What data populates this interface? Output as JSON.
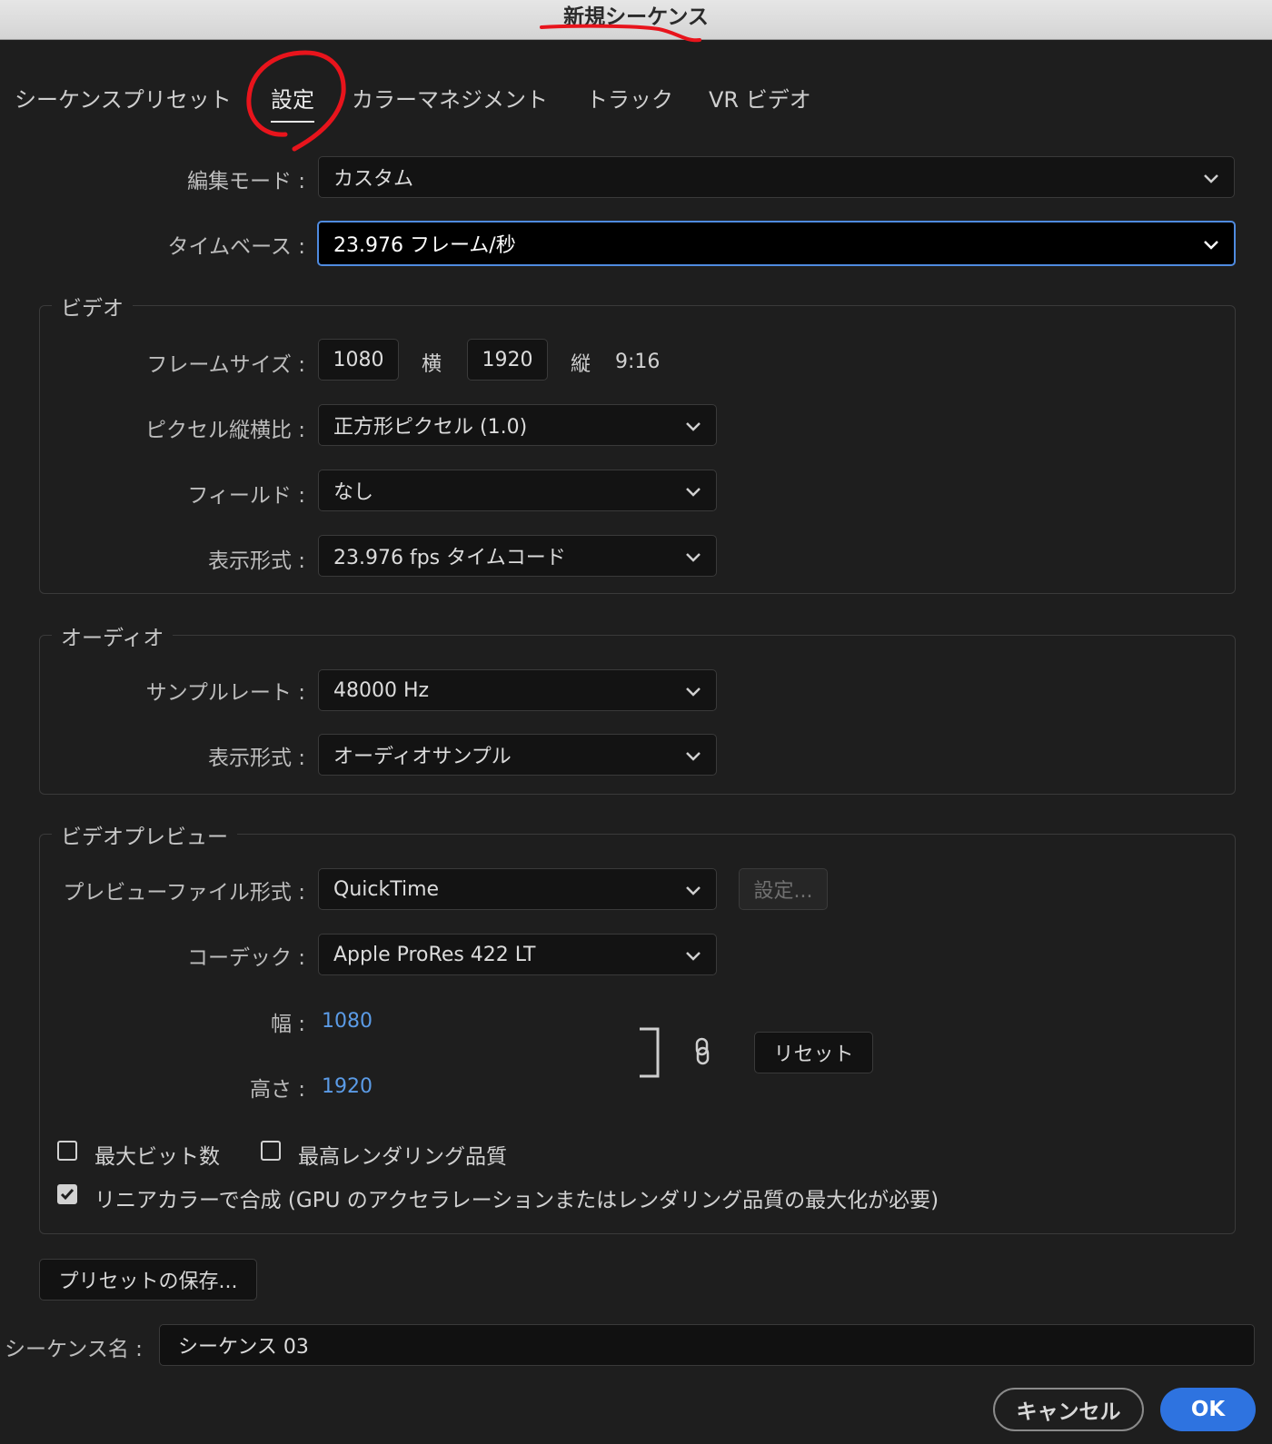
{
  "window": {
    "title": "新規シーケンス"
  },
  "tabs": [
    {
      "label": "シーケンスプリセット"
    },
    {
      "label": "設定"
    },
    {
      "label": "カラーマネジメント"
    },
    {
      "label": "トラック"
    },
    {
      "label": "VR ビデオ"
    }
  ],
  "general": {
    "editing_mode_label": "編集モード :",
    "editing_mode_value": "カスタム",
    "timebase_label": "タイムベース :",
    "timebase_value": "23.976  フレーム/秒"
  },
  "video": {
    "group_title": "ビデオ",
    "frame_size_label": "フレームサイズ :",
    "frame_width": "1080",
    "horizontal_label": "横",
    "frame_height": "1920",
    "vertical_label": "縦",
    "aspect": "9:16",
    "pixel_aspect_label": "ピクセル縦横比 :",
    "pixel_aspect_value": "正方形ピクセル (1.0)",
    "fields_label": "フィールド :",
    "fields_value": "なし",
    "display_format_label": "表示形式 :",
    "display_format_value": "23.976 fps タイムコード"
  },
  "audio": {
    "group_title": "オーディオ",
    "sample_rate_label": "サンプルレート :",
    "sample_rate_value": "48000 Hz",
    "display_format_label": "表示形式 :",
    "display_format_value": "オーディオサンプル"
  },
  "preview": {
    "group_title": "ビデオプレビュー",
    "file_format_label": "プレビューファイル形式 :",
    "file_format_value": "QuickTime",
    "settings_button": "設定...",
    "codec_label": "コーデック :",
    "codec_value": "Apple ProRes 422 LT",
    "width_label": "幅 :",
    "width_value": "1080",
    "height_label": "高さ :",
    "height_value": "1920",
    "reset_button": "リセット",
    "max_bit_depth": "最大ビット数",
    "max_render_quality": "最高レンダリング品質",
    "linear_color": "リニアカラーで合成 (GPU のアクセラレーションまたはレンダリング品質の最大化が必要)",
    "max_bit_depth_checked": false,
    "max_render_quality_checked": false,
    "linear_color_checked": true
  },
  "footer": {
    "save_preset_button": "プリセットの保存...",
    "sequence_name_label": "シーケンス名 :",
    "sequence_name_value": "シーケンス 03",
    "cancel_button": "キャンセル",
    "ok_button": "OK"
  },
  "colors": {
    "accent": "#2e73e0",
    "focus_border": "#4f8be0",
    "value_blue": "#5b9be6",
    "annotation_red": "#e8141c"
  },
  "icons": {
    "dropdown": "chevron-down-icon",
    "link": "link-icon",
    "checkbox": "checkmark-icon"
  }
}
